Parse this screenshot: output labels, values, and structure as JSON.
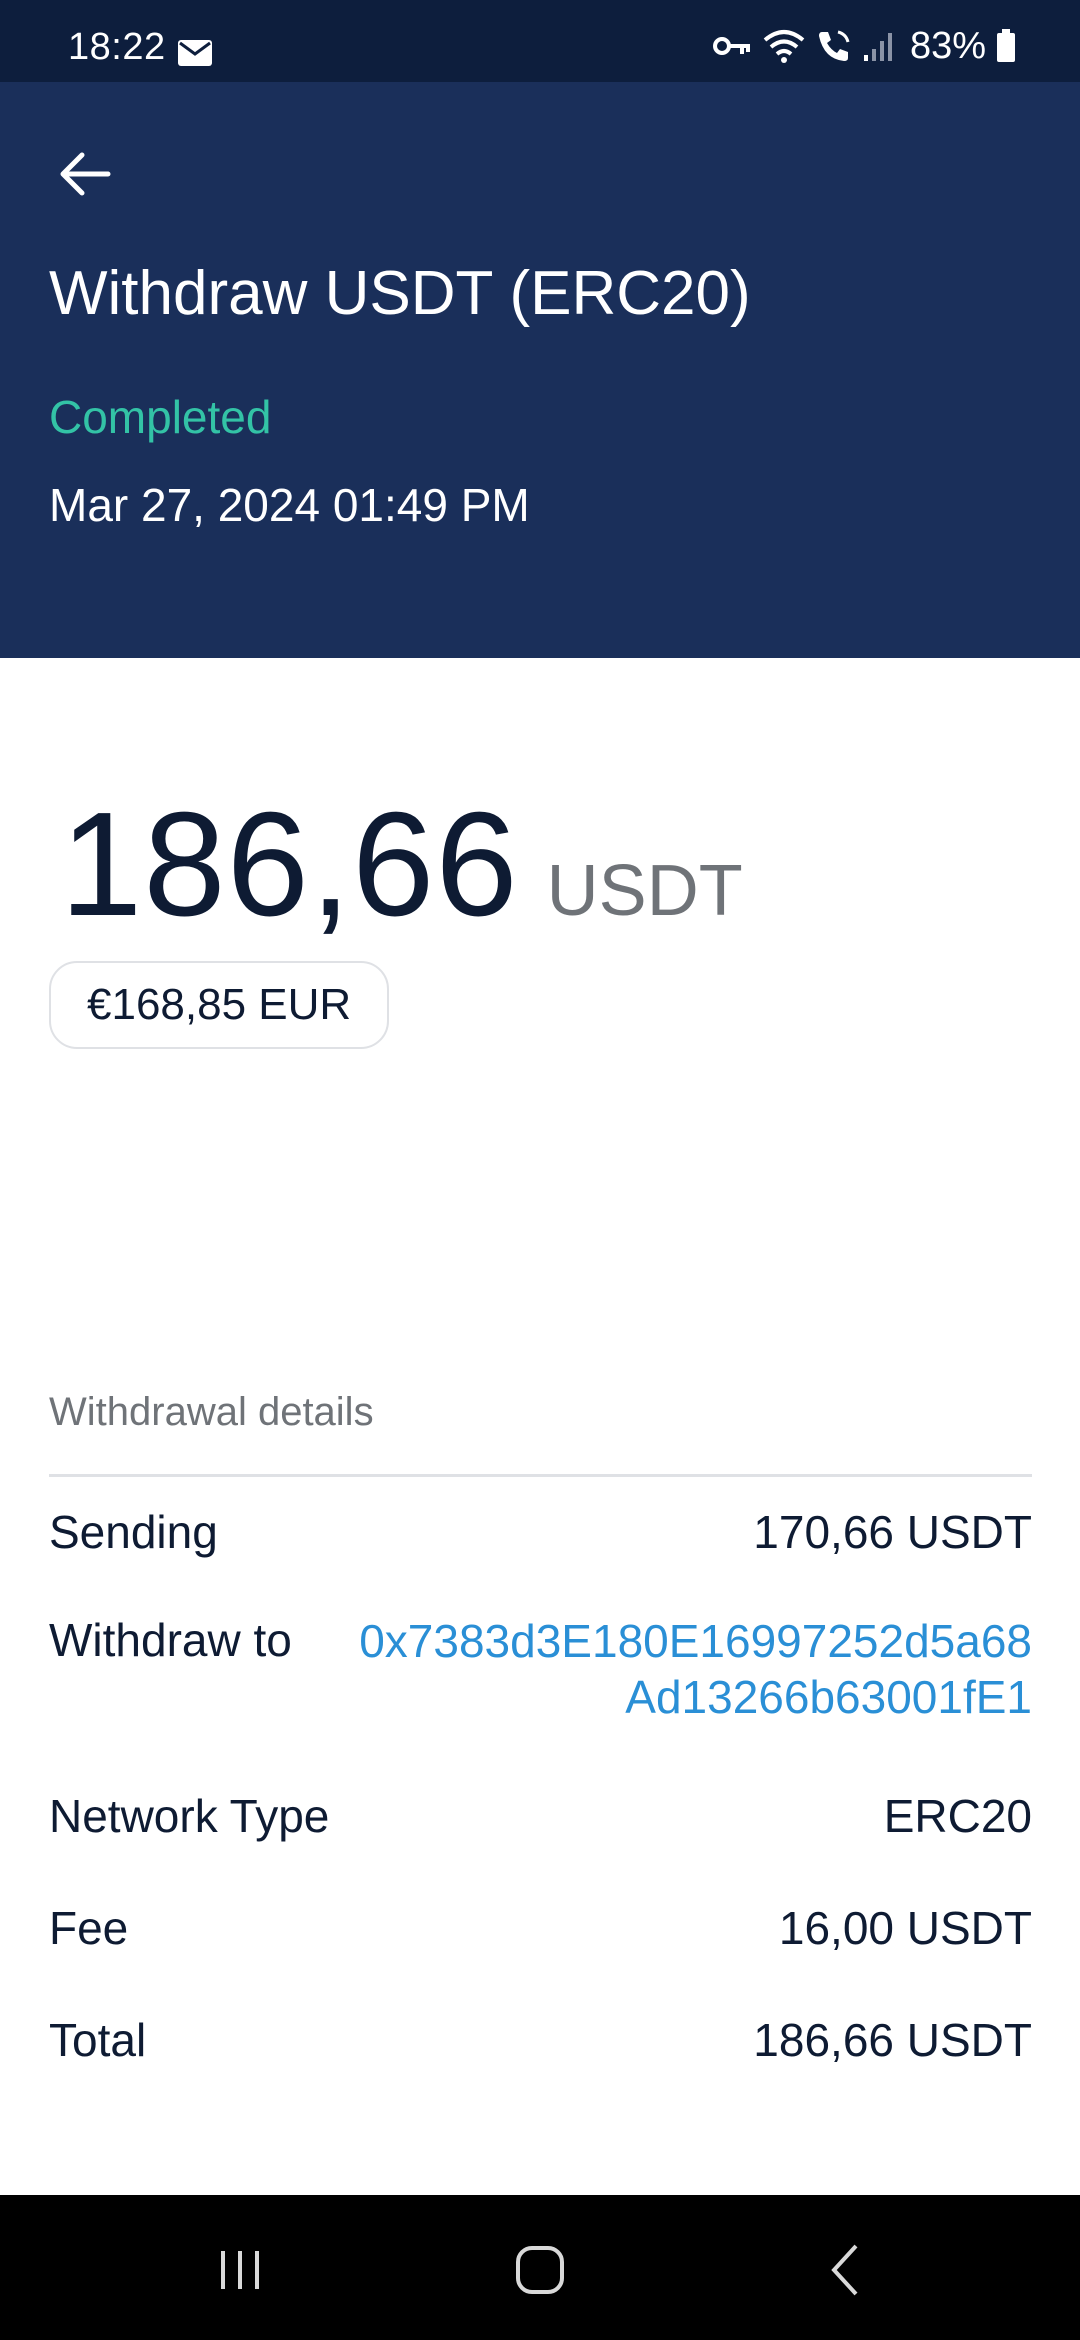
{
  "status_bar": {
    "time": "18:22",
    "battery": "83%",
    "icons": [
      "mail-icon",
      "vpn-key-icon",
      "wifi-icon",
      "wifi-calling-icon",
      "signal-icon",
      "battery-icon"
    ]
  },
  "header": {
    "title": "Withdraw USDT (ERC20)",
    "status": "Completed",
    "datetime": "Mar 27, 2024 01:49 PM",
    "colors": {
      "background": "#1a2f5a",
      "status": "#33c3a6"
    }
  },
  "amount": {
    "value": "186,66",
    "unit": "USDT",
    "fiat": "€168,85 EUR"
  },
  "details": {
    "heading": "Withdrawal details",
    "rows": [
      {
        "label": "Sending",
        "value": "170,66 USDT"
      },
      {
        "label": "Withdraw to",
        "value": "0x7383d3E180E16997252d5a68Ad13266b63001fE1"
      },
      {
        "label": "Network Type",
        "value": "ERC20"
      },
      {
        "label": "Fee",
        "value": "16,00 USDT"
      },
      {
        "label": "Total",
        "value": "186,66 USDT"
      }
    ],
    "link_color": "#2a8fd6"
  },
  "nav": [
    "recent-apps-icon",
    "home-icon",
    "back-icon"
  ]
}
